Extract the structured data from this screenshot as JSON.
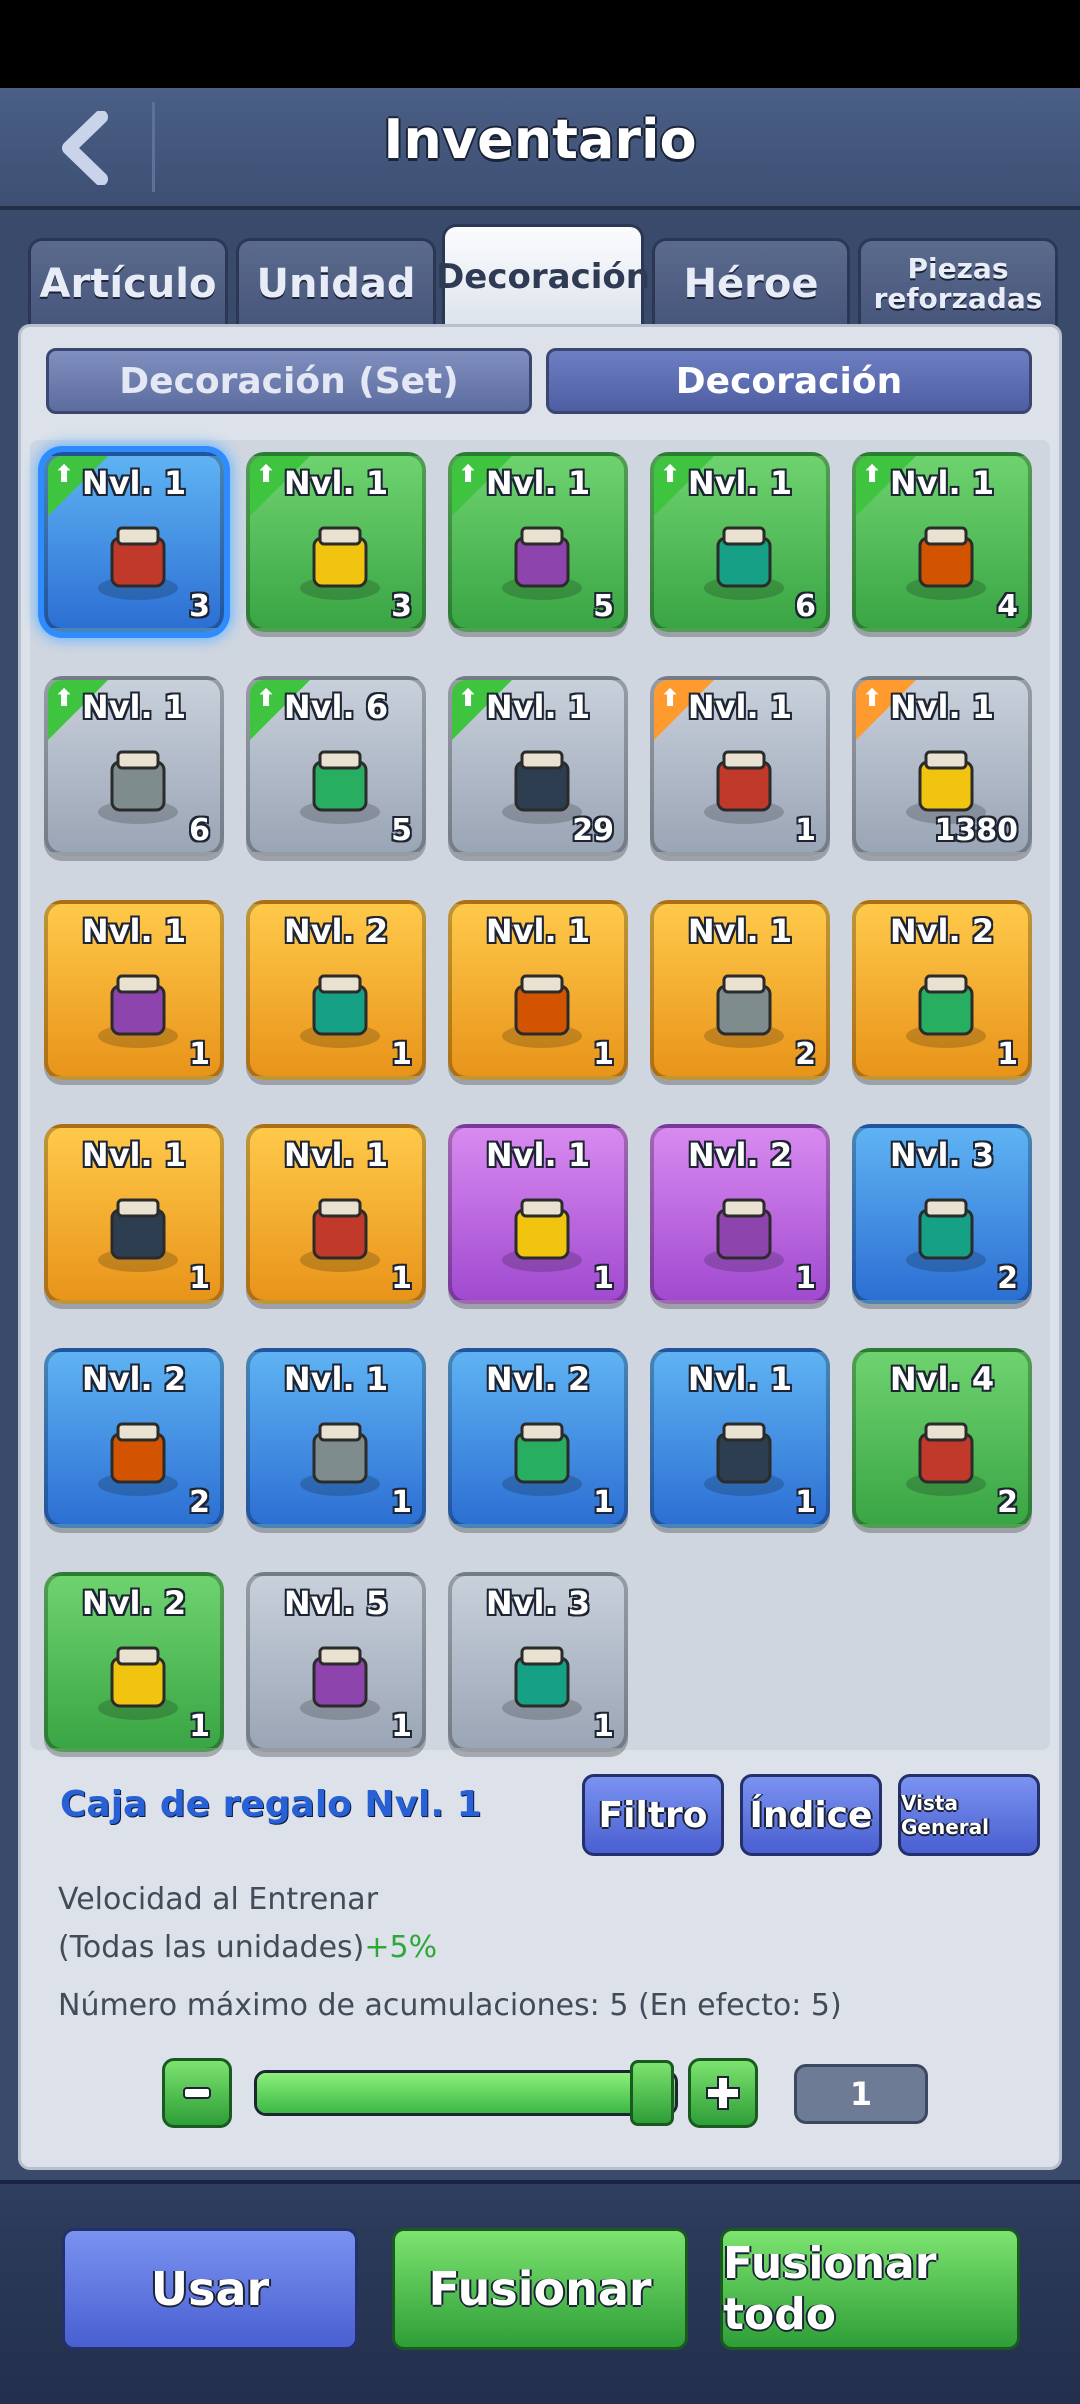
{
  "header": {
    "title": "Inventario"
  },
  "tabs": [
    {
      "label": "Artículo"
    },
    {
      "label": "Unidad"
    },
    {
      "label": "Decoración"
    },
    {
      "label": "Héroe"
    },
    {
      "label": "Piezas reforzadas"
    }
  ],
  "subtabs": [
    {
      "label": "Decoración (Set)"
    },
    {
      "label": "Decoración"
    }
  ],
  "items": [
    {
      "level": "Nvl. 1",
      "qty": "3",
      "color": "#3b7ee0",
      "icon": "gift-box-icon"
    },
    {
      "level": "Nvl. 1",
      "qty": "3",
      "color": "#3aa544",
      "icon": "dark-tile-icon"
    },
    {
      "level": "Nvl. 1",
      "qty": "5",
      "color": "#3aa544",
      "icon": "checkered-tile-icon"
    },
    {
      "level": "Nvl. 1",
      "qty": "6",
      "color": "#3aa544",
      "icon": "lantern-icon"
    },
    {
      "level": "Nvl. 1",
      "qty": "4",
      "color": "#3aa544",
      "icon": "stone-building-icon"
    },
    {
      "level": "Nvl. 1",
      "qty": "6",
      "color": "#9aa5b5",
      "icon": "tree-icon"
    },
    {
      "level": "Nvl. 6",
      "qty": "5",
      "color": "#9aa5b5",
      "icon": "tower-icon"
    },
    {
      "level": "Nvl. 1",
      "qty": "29",
      "color": "#9aa5b5",
      "icon": "tower-icon"
    },
    {
      "level": "Nvl. 1",
      "qty": "1",
      "color": "#9aa5b5",
      "icon": "sand-tile-icon"
    },
    {
      "level": "Nvl. 1",
      "qty": "1380",
      "color": "#9aa5b5",
      "icon": "snow-tree-icon"
    },
    {
      "level": "Nvl. 1",
      "qty": "1",
      "color": "#e8941a",
      "icon": "golden-carriage-icon"
    },
    {
      "level": "Nvl. 2",
      "qty": "1",
      "color": "#e8941a",
      "icon": "monster-statue-icon"
    },
    {
      "level": "Nvl. 1",
      "qty": "1",
      "color": "#e8941a",
      "icon": "cake-icon"
    },
    {
      "level": "Nvl. 1",
      "qty": "2",
      "color": "#e8941a",
      "icon": "crate-stack-icon"
    },
    {
      "level": "Nvl. 2",
      "qty": "1",
      "color": "#e8941a",
      "icon": "shop-building-icon"
    },
    {
      "level": "Nvl. 1",
      "qty": "1",
      "color": "#e8941a",
      "icon": "fence-icon"
    },
    {
      "level": "Nvl. 1",
      "qty": "1",
      "color": "#e8941a",
      "icon": "balloon-icon"
    },
    {
      "level": "Nvl. 1",
      "qty": "1",
      "color": "#a04ad0",
      "icon": "unicorn-icon"
    },
    {
      "level": "Nvl. 2",
      "qty": "1",
      "color": "#a04ad0",
      "icon": "balloon-bunch-icon"
    },
    {
      "level": "Nvl. 3",
      "qty": "2",
      "color": "#2c6fd3",
      "icon": "bench-icon"
    },
    {
      "level": "Nvl. 2",
      "qty": "2",
      "color": "#2c6fd3",
      "icon": "bench-icon"
    },
    {
      "level": "Nvl. 1",
      "qty": "1",
      "color": "#2c6fd3",
      "icon": "bench-icon"
    },
    {
      "level": "Nvl. 2",
      "qty": "1",
      "color": "#2c6fd3",
      "icon": "fountain-icon"
    },
    {
      "level": "Nvl. 1",
      "qty": "1",
      "color": "#2c6fd3",
      "icon": "fountain-icon"
    },
    {
      "level": "Nvl. 4",
      "qty": "2",
      "color": "#3aa544",
      "icon": "lantern-icon"
    },
    {
      "level": "Nvl. 2",
      "qty": "1",
      "color": "#3aa544",
      "icon": "lantern-icon"
    },
    {
      "level": "Nvl. 5",
      "qty": "1",
      "color": "#9aa5b5",
      "icon": "tower-icon"
    },
    {
      "level": "Nvl. 3",
      "qty": "1",
      "color": "#9aa5b5",
      "icon": "tower-icon"
    }
  ],
  "selected": {
    "name": "Caja de regalo Nvl. 1",
    "effect_label": "Velocidad al Entrenar",
    "effect_scope": "(Todas las unidades)",
    "effect_value": "+5%",
    "stack_info": "Número máximo de acumulaciones: 5 (En efecto: 5)",
    "quantity": "1",
    "quantity_fraction": 1.0
  },
  "actions": {
    "filter": "Filtro",
    "index": "Índice",
    "overview": "Vista General",
    "use": "Usar",
    "merge": "Fusionar",
    "merge_all": "Fusionar todo"
  },
  "colors": {
    "accent_blue": "#2860d6",
    "bonus_green": "#2fa83a"
  }
}
